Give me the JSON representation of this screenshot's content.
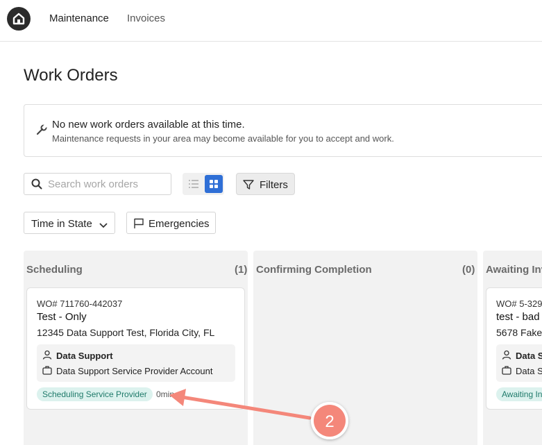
{
  "nav": {
    "items": [
      "Maintenance",
      "Invoices"
    ]
  },
  "page": {
    "title": "Work Orders"
  },
  "notice": {
    "title": "No new work orders available at this time.",
    "subtitle": "Maintenance requests in your area may become available for you to accept and work."
  },
  "search": {
    "placeholder": "Search work orders",
    "value": ""
  },
  "toolbar": {
    "filters_label": "Filters",
    "time_label": "Time in State",
    "emergencies_label": "Emergencies",
    "view_mode": "grid"
  },
  "columns": [
    {
      "title": "Scheduling",
      "count": "(1)",
      "card": {
        "wo": "WO# 711760-442037",
        "title": "Test - Only",
        "address": "12345 Data Support Test, Florida City, FL",
        "person": "Data Support",
        "account": "Data Support Service Provider Account",
        "status": "Scheduling Service Provider",
        "time": "0min"
      }
    },
    {
      "title": "Confirming Completion",
      "count": "(0)"
    },
    {
      "title": "Awaiting Inv",
      "card": {
        "wo": "WO# 5-329",
        "title": "test - bad",
        "address": "5678 Fake",
        "person": "Data Su",
        "account": "Data Su",
        "status": "Awaiting In"
      }
    }
  ],
  "annotation": {
    "label": "2",
    "color": "#f4877a"
  },
  "colors": {
    "accent": "#2f6fd6",
    "badge_bg": "#dcf2ee",
    "badge_text": "#1f7a6a"
  }
}
